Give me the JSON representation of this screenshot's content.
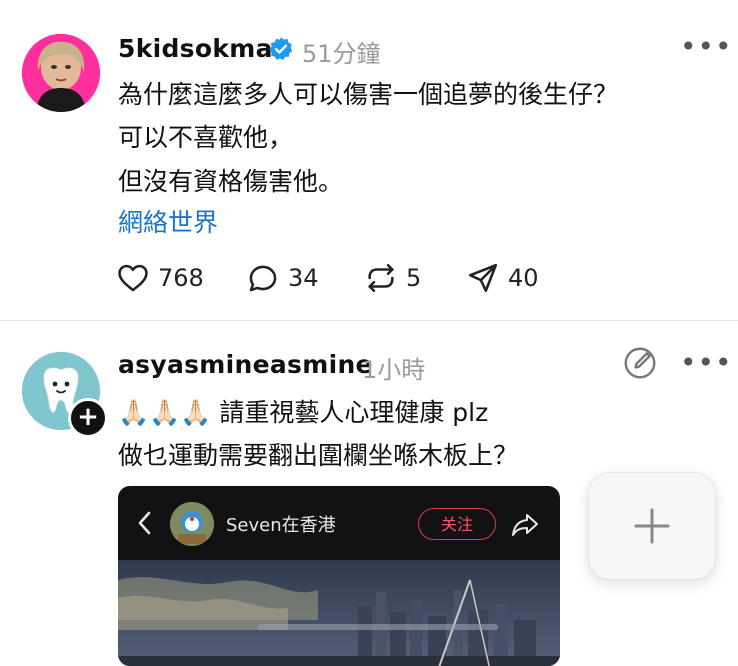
{
  "post1": {
    "username": "5kidsokma",
    "time": "51分鐘",
    "lines": [
      "為什麼這麼多人可以傷害一個追夢的後生仔？",
      "可以不喜歡他，",
      "但沒有資格傷害他。"
    ],
    "tag": "網絡世界",
    "likes": "768",
    "comments": "34",
    "reposts": "5",
    "shares": "40"
  },
  "post2": {
    "username": "asyasmineasmine",
    "time": "1小時",
    "emoji": "🙏🏻🙏🏻🙏🏻",
    "line1": "請重視藝人心理健康 plz",
    "line2": "做乜運動需要翻出圍欄坐喺木板上？",
    "embed": {
      "name": "Seven在香港",
      "follow_label": "关注"
    }
  },
  "colors": {
    "link": "#1f74c9",
    "verified": "#1d9bf0",
    "follow": "#e03b4a"
  },
  "icons": [
    "heart-icon",
    "comment-icon",
    "repost-icon",
    "share-icon",
    "verified-icon",
    "more-icon",
    "edit-icon",
    "plus-icon",
    "back-icon"
  ]
}
